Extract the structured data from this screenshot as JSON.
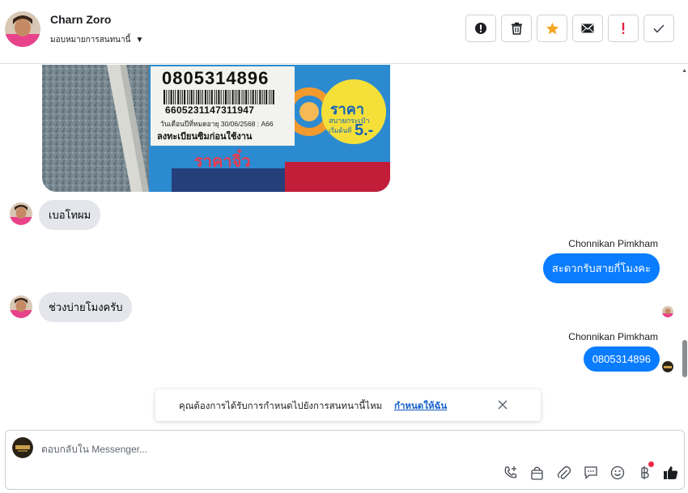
{
  "header": {
    "contact_name": "Charn Zoro",
    "assign_label": "มอบหมายการสนทนานี้",
    "actions": [
      {
        "name": "spam-button",
        "icon": "alert-circle-icon"
      },
      {
        "name": "delete-button",
        "icon": "trash-icon"
      },
      {
        "name": "star-button",
        "icon": "star-icon"
      },
      {
        "name": "mark-unread-button",
        "icon": "envelope-icon"
      },
      {
        "name": "follow-up-button",
        "icon": "exclamation-icon"
      },
      {
        "name": "mark-done-button",
        "icon": "check-icon"
      }
    ]
  },
  "photo": {
    "phone_number": "0805314896",
    "barcode_number": "6605231147311947",
    "expiry": "วันเดือนปีที่หมดอายุ 30/06/2568 : A66",
    "register_note": "ลงทะเบียนซิมก่อนใช้งาน",
    "price_title": "ราคา",
    "price_sub1": "สบายกระเป๋า",
    "price_sub2": "เริ่มต้นที่",
    "price_value": "5.-",
    "brand_text": "ราคาจิ๋ว"
  },
  "messages": [
    {
      "direction": "in",
      "text": "เบอโทผม"
    },
    {
      "direction": "out",
      "sender": "Chonnikan Pimkham",
      "text": "สะดวกรับสายกี่โมงคะ"
    },
    {
      "direction": "in",
      "text": "ช่วงบ่ายโมงครับ"
    },
    {
      "direction": "out",
      "sender": "Chonnikan Pimkham",
      "text": "0805314896"
    }
  ],
  "banner": {
    "text": "คุณต้องการได้รับการกำหนดไปยังการสนทนานี้ไหม",
    "link": "กำหนดให้ฉัน"
  },
  "composer": {
    "placeholder": "ตอบกลับใน Messenger...",
    "tools": [
      "phone-add-icon",
      "shopping-bag-icon",
      "paperclip-icon",
      "chat-bubble-icon",
      "smiley-icon",
      "baht-icon",
      "thumbs-up-icon"
    ]
  },
  "colors": {
    "outgoing_bubble": "#0a7cff",
    "incoming_bubble": "#e4e6eb",
    "star": "#f5a623",
    "urgent": "#e41e3f",
    "link": "#1660c9"
  }
}
